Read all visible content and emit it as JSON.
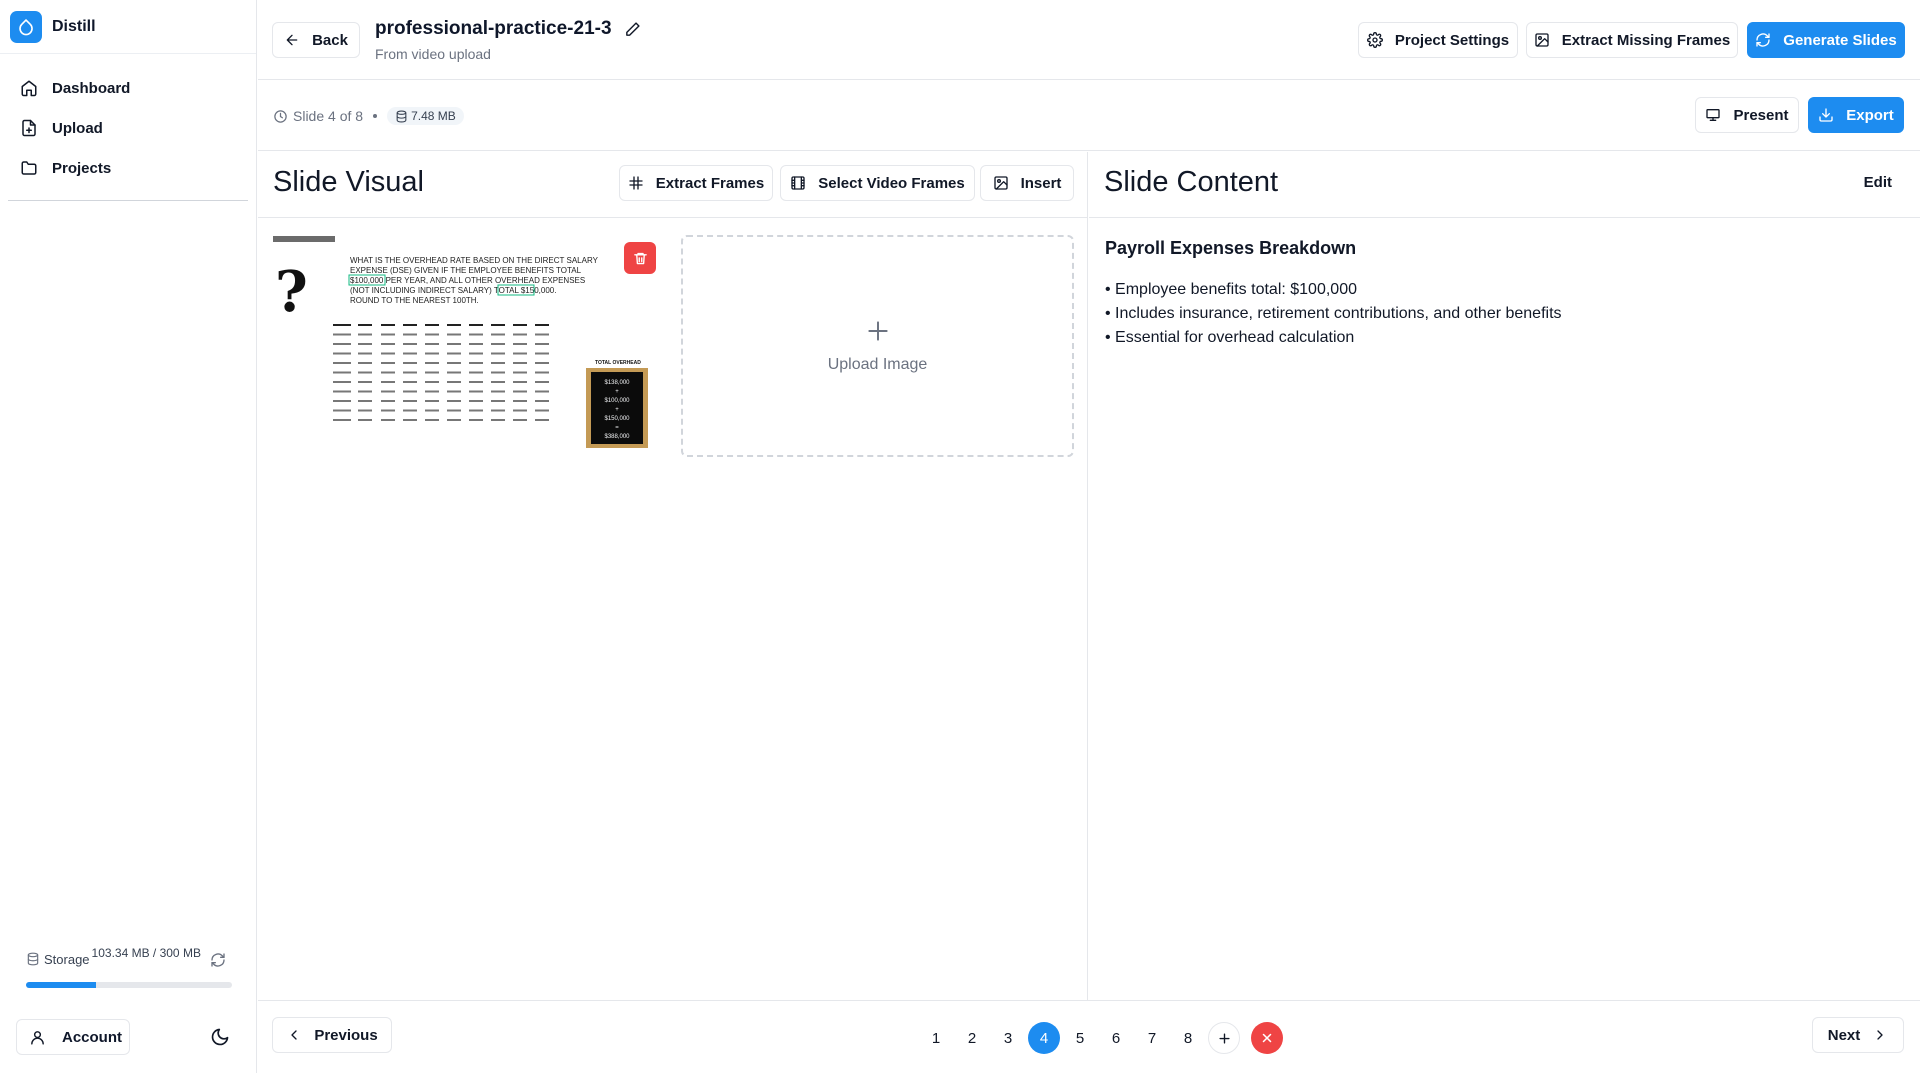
{
  "app": {
    "name": "Distill"
  },
  "sidebar": {
    "items": [
      {
        "label": "Dashboard",
        "icon": "home-icon"
      },
      {
        "label": "Upload",
        "icon": "file-plus-icon"
      },
      {
        "label": "Projects",
        "icon": "folder-icon"
      }
    ],
    "storage": {
      "label": "Storage",
      "value": "103.34 MB / 300 MB",
      "used_fraction": 0.34
    },
    "account_label": "Account"
  },
  "header": {
    "back_label": "Back",
    "project_title": "professional-practice-21-3",
    "project_subtitle": "From video upload",
    "project_settings_label": "Project Settings",
    "extract_missing_label": "Extract Missing Frames",
    "generate_slides_label": "Generate Slides"
  },
  "infobar": {
    "slide_position": "Slide 4 of 8",
    "file_size": "7.48 MB",
    "present_label": "Present",
    "export_label": "Export"
  },
  "visual_panel": {
    "title": "Slide Visual",
    "extract_frames_label": "Extract Frames",
    "select_video_frames_label": "Select Video Frames",
    "insert_label": "Insert",
    "upload_label": "Upload Image",
    "thumbnail": {
      "question_text": "WHAT IS THE OVERHEAD RATE BASED ON THE DIRECT SALARY EXPENSE (DSE) GIVEN IF THE EMPLOYEE BENEFITS TOTAL $100,000 PER YEAR, AND ALL OTHER OVERHEAD EXPENSES (NOT INCLUDING INDIRECT SALARY) TOTAL $150,000. ROUND TO THE NEAREST 100TH.",
      "board_lines": [
        "$138,000",
        "+",
        "$100,000",
        "+",
        "$150,000",
        "=",
        "$388,000"
      ],
      "board_title": "TOTAL OVERHEAD"
    }
  },
  "content_panel": {
    "title": "Slide Content",
    "edit_label": "Edit",
    "slide_title": "Payroll Expenses Breakdown",
    "bullets": [
      "• Employee benefits total: $100,000",
      "• Includes insurance, retirement contributions, and other benefits",
      "• Essential for overhead calculation"
    ]
  },
  "footer": {
    "previous_label": "Previous",
    "next_label": "Next",
    "pages": [
      "1",
      "2",
      "3",
      "4",
      "5",
      "6",
      "7",
      "8"
    ],
    "current_page": "4"
  },
  "colors": {
    "accent": "#1d8cf0",
    "danger": "#ef4444",
    "border": "#e5e7eb",
    "muted": "#6b7280"
  }
}
